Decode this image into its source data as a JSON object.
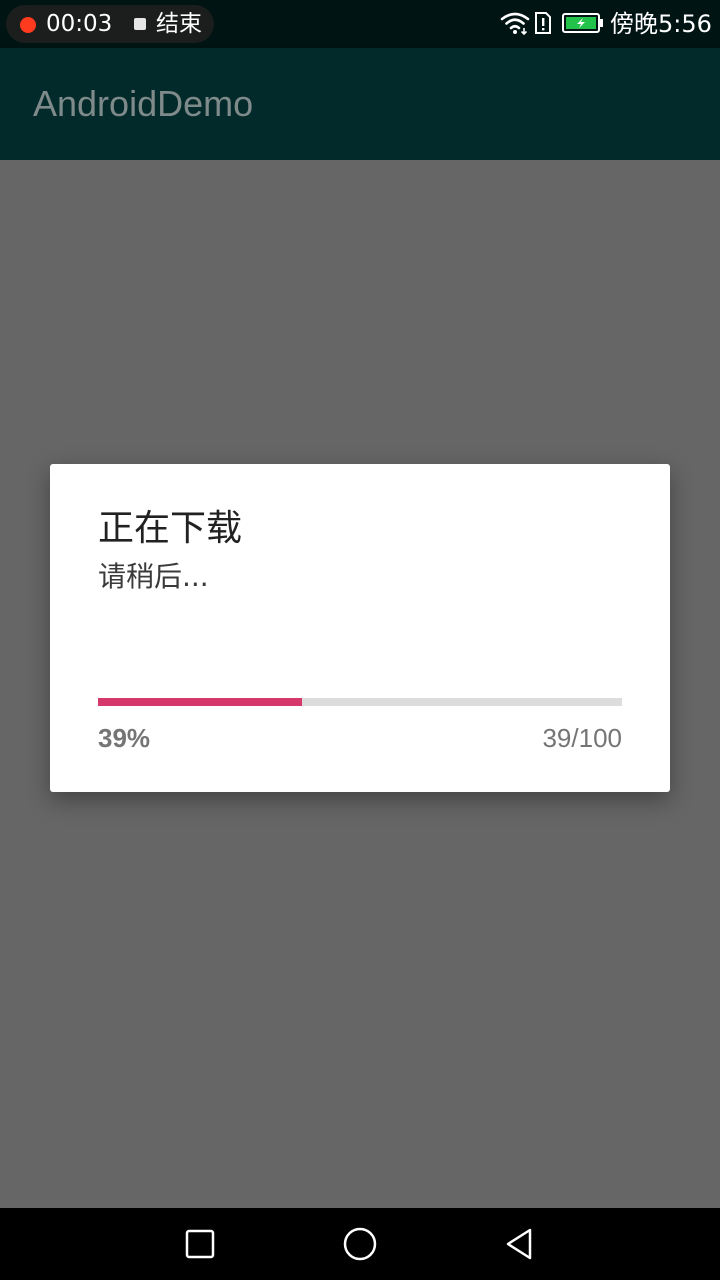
{
  "status_bar": {
    "recording_time": "00:03",
    "end_label": "结束",
    "clock": "傍晚5:56",
    "icons": [
      "record-dot-icon",
      "stop-square-icon",
      "wifi-icon",
      "sim-alert-icon",
      "battery-charging-icon"
    ],
    "battery_color": "#23c24a",
    "record_color": "#ff3b1f"
  },
  "app_bar": {
    "title": "AndroidDemo",
    "background": "#032a2a"
  },
  "dialog": {
    "title": "正在下载",
    "message": "请稍后...",
    "progress": {
      "value": 39,
      "max": 100,
      "percent_label": "39%",
      "count_label": "39/100",
      "fill_color": "#d6386b",
      "track_color": "#dcdcdc"
    }
  },
  "nav_bar": {
    "buttons": [
      "recent-apps-icon",
      "home-icon",
      "back-icon"
    ]
  }
}
